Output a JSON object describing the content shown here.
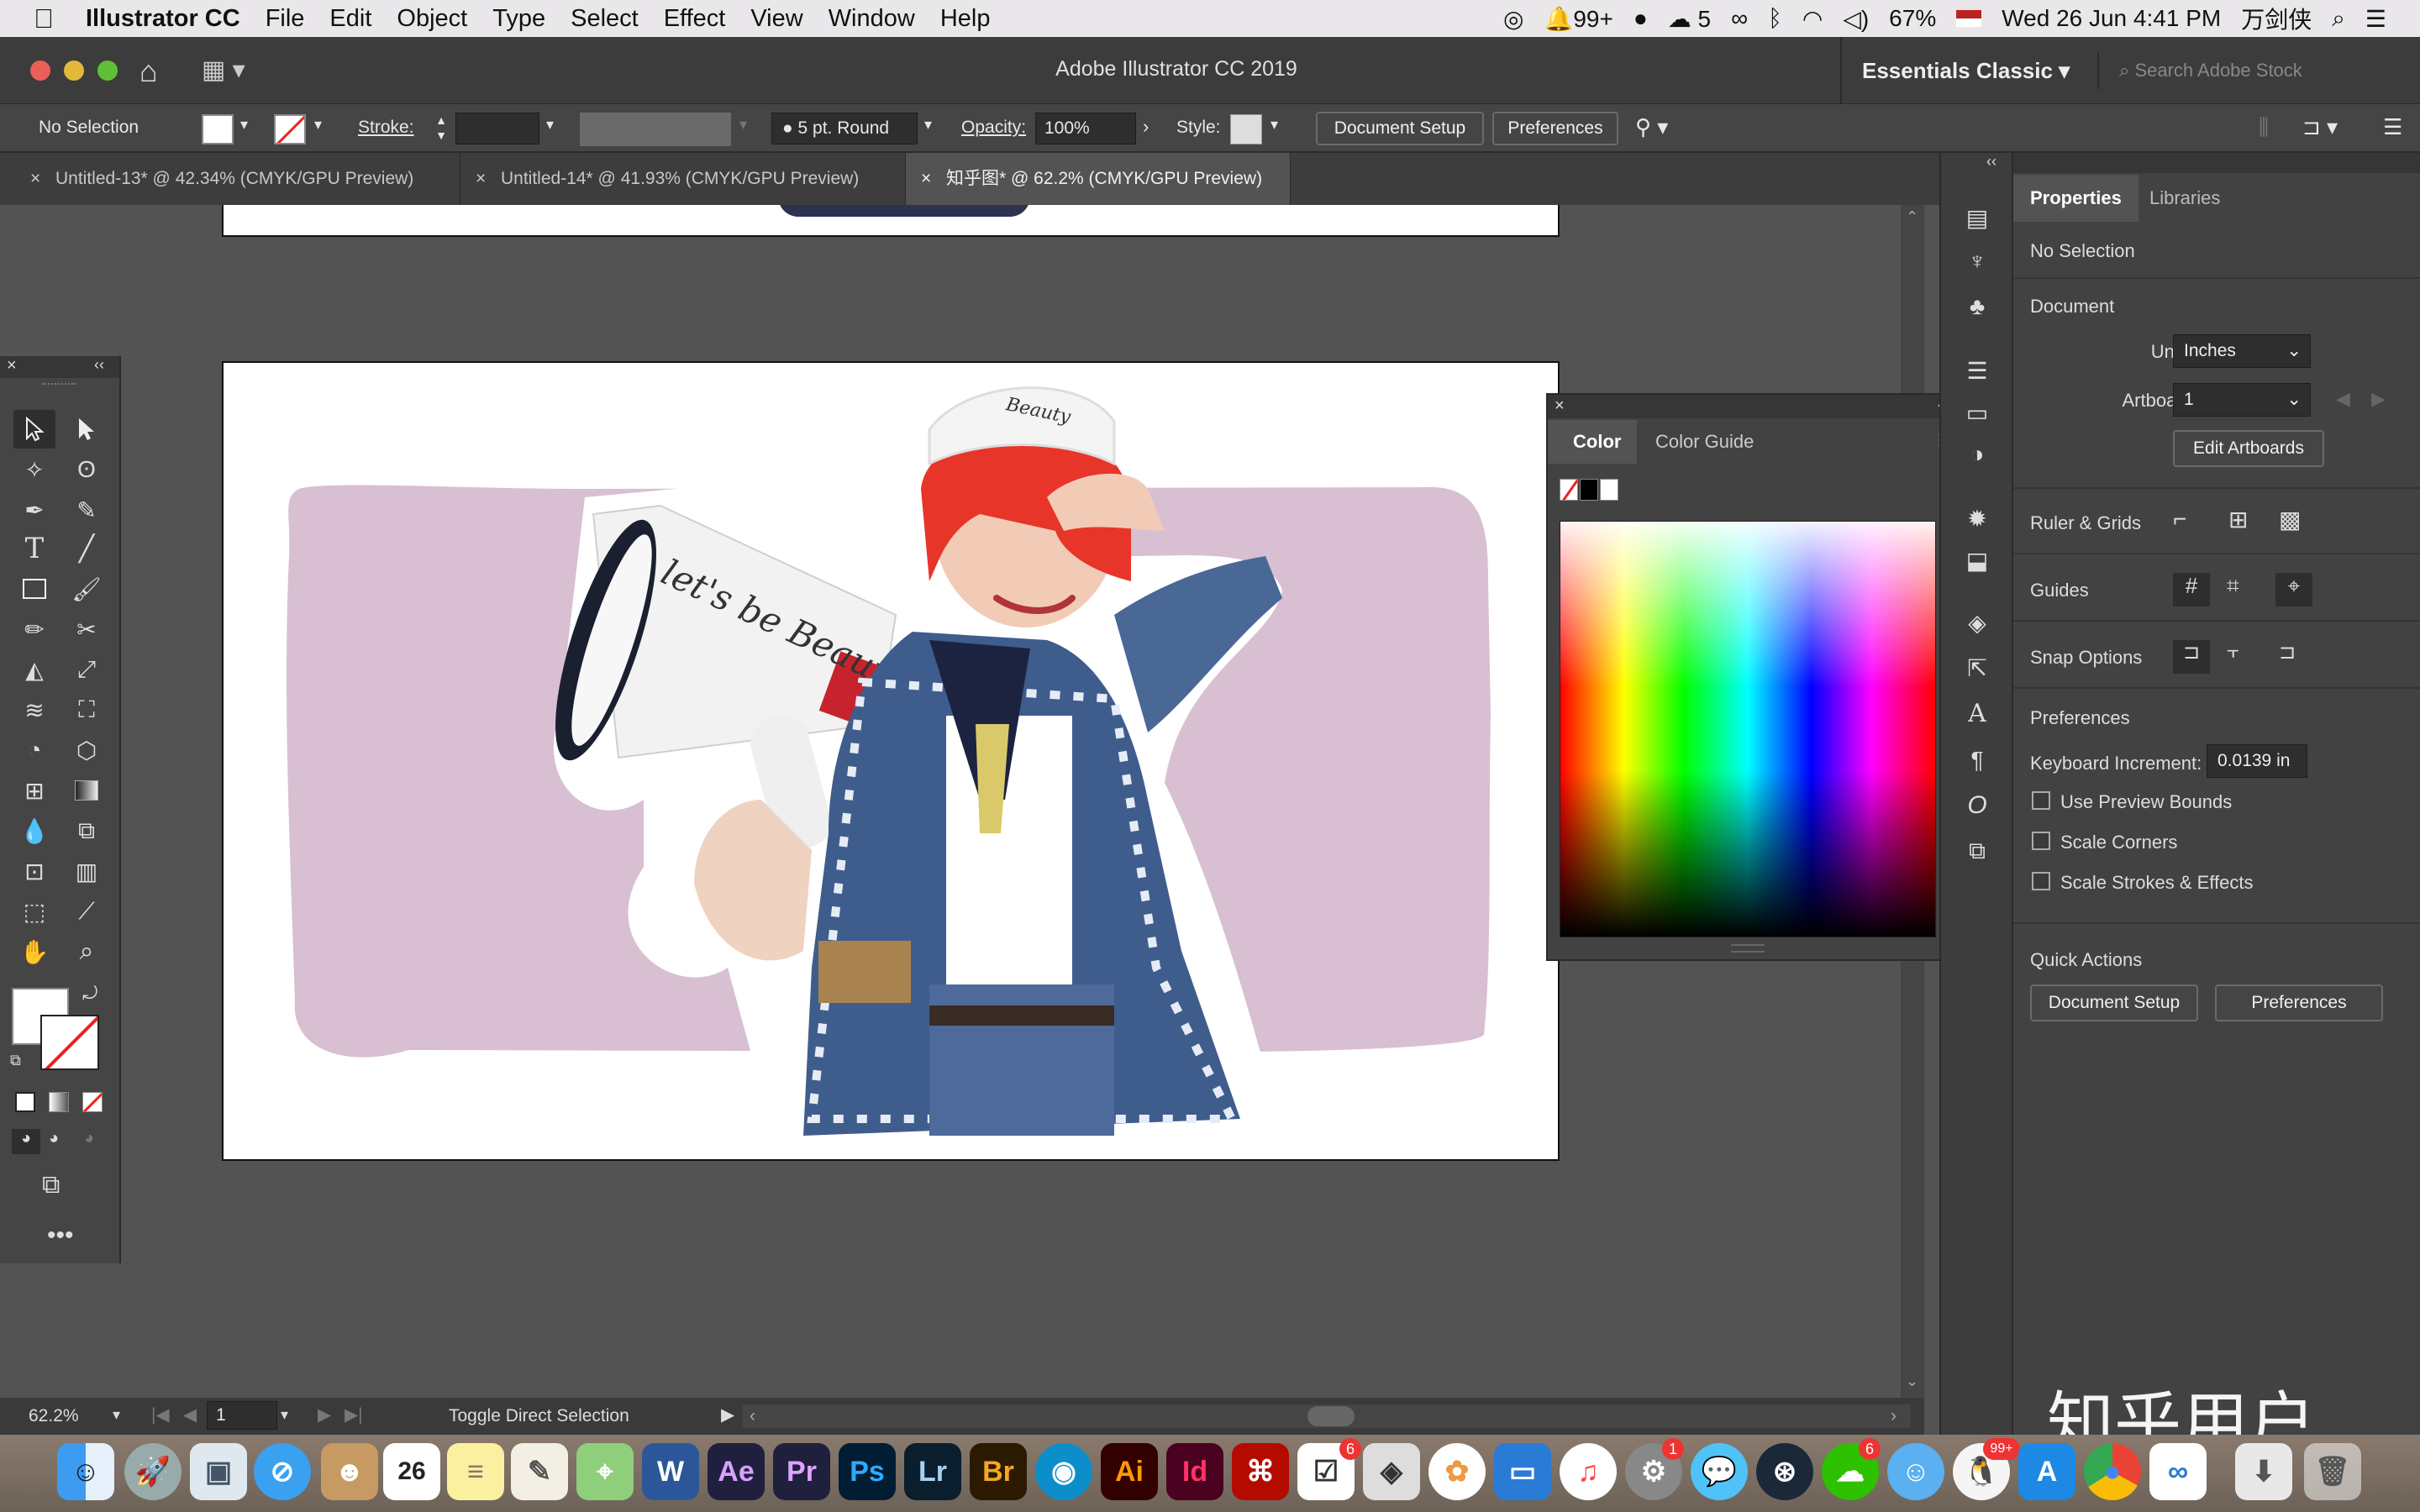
{
  "menubar": {
    "app_name": "Illustrator CC",
    "items": [
      "File",
      "Edit",
      "Object",
      "Type",
      "Select",
      "Effect",
      "View",
      "Window",
      "Help"
    ],
    "status": {
      "notifications": "99+",
      "wechat_count": "5",
      "battery": "67%",
      "datetime": "Wed 26 Jun  4:41 PM",
      "user": "万剑侠"
    }
  },
  "titlebar": {
    "title": "Adobe Illustrator CC 2019",
    "workspace": "Essentials Classic",
    "search_placeholder": "Search Adobe Stock"
  },
  "control": {
    "selection": "No Selection",
    "stroke_label": "Stroke:",
    "brush": "5 pt. Round",
    "opacity_label": "Opacity:",
    "opacity": "100%",
    "style_label": "Style:",
    "document_setup": "Document Setup",
    "preferences": "Preferences"
  },
  "tabs": [
    {
      "label": "Untitled-13* @ 42.34% (CMYK/GPU Preview)"
    },
    {
      "label": "Untitled-14* @ 41.93% (CMYK/GPU Preview)"
    },
    {
      "label": "知乎图* @ 62.2% (CMYK/GPU Preview)"
    }
  ],
  "artwork": {
    "megaphone_text": "let's be Beauty",
    "hat_text": "Beauty"
  },
  "status": {
    "zoom": "62.2%",
    "artboard": "1",
    "tool_hint": "Toggle Direct Selection"
  },
  "color_panel": {
    "tab_color": "Color",
    "tab_guide": "Color Guide"
  },
  "properties": {
    "tab_properties": "Properties",
    "tab_libraries": "Libraries",
    "selection": "No Selection",
    "document_heading": "Document",
    "units_label": "Units:",
    "units_value": "Inches",
    "artboard_label": "Artboard:",
    "artboard_value": "1",
    "edit_artboards": "Edit Artboards",
    "ruler_grids": "Ruler & Grids",
    "guides": "Guides",
    "snap_options": "Snap Options",
    "preferences_heading": "Preferences",
    "keyboard_increment_label": "Keyboard Increment:",
    "keyboard_increment_value": "0.0139 in",
    "use_preview_bounds": "Use Preview Bounds",
    "scale_corners": "Scale Corners",
    "scale_strokes": "Scale Strokes & Effects",
    "quick_actions": "Quick Actions",
    "document_setup": "Document Setup",
    "preferences_btn": "Preferences"
  },
  "dock": {
    "apps": [
      "Ae",
      "Pr",
      "Ps",
      "Lr",
      "Br",
      "Ai",
      "Id"
    ],
    "badges": {
      "reminders": "6",
      "system_prefs": "1",
      "wechat": "6",
      "qq": "99+"
    }
  },
  "watermark": "知乎用户",
  "colors": {
    "accent_pink": "#d8bfd2",
    "hair_red": "#e8352a",
    "ui_dark": "#424242"
  }
}
